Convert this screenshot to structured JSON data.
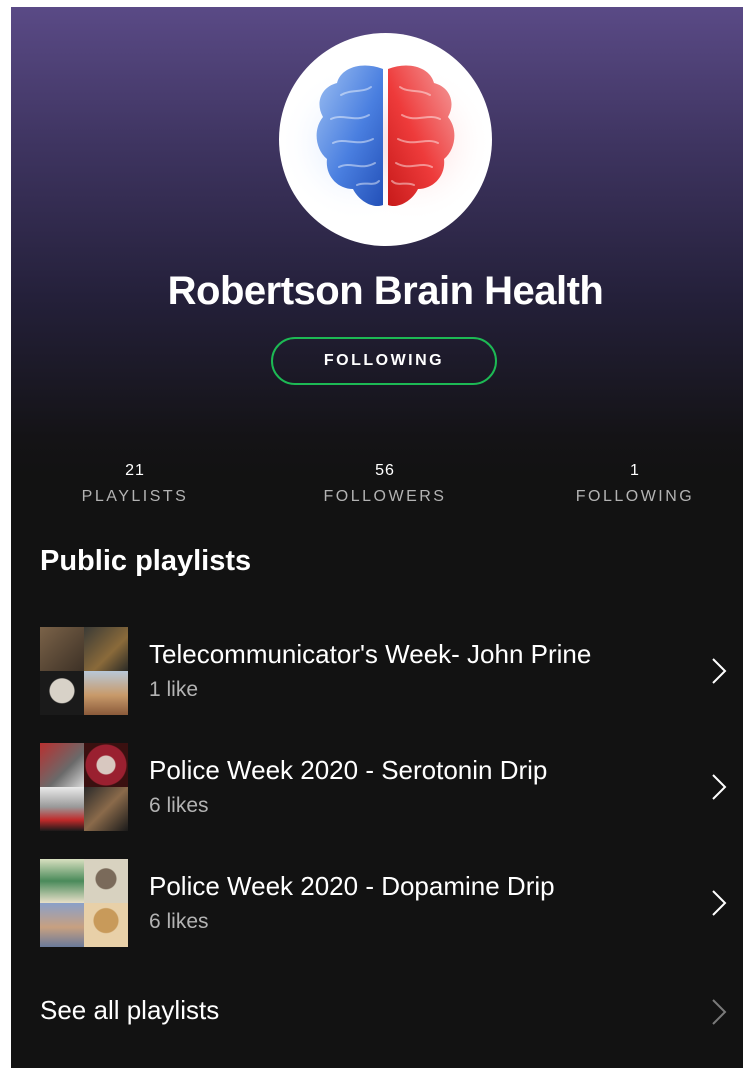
{
  "profile": {
    "name": "Robertson Brain Health",
    "avatar_icon": "brain-icon",
    "follow_button_label": "FOLLOWING"
  },
  "stats": [
    {
      "value": "21",
      "label": "PLAYLISTS"
    },
    {
      "value": "56",
      "label": "FOLLOWERS"
    },
    {
      "value": "1",
      "label": "FOLLOWING"
    }
  ],
  "section_title": "Public playlists",
  "playlists": [
    {
      "title": "Telecommunicator's Week- John Prine",
      "likes": "1 like"
    },
    {
      "title": "Police Week 2020 - Serotonin Drip",
      "likes": "6 likes"
    },
    {
      "title": "Police Week 2020 - Dopamine Drip",
      "likes": "6 likes"
    }
  ],
  "see_all_label": "See all playlists",
  "colors": {
    "accent_green": "#1db954",
    "header_purple": "#5a4a86",
    "background": "#121212",
    "text_primary": "#ffffff",
    "text_secondary": "#b3b3b3"
  }
}
